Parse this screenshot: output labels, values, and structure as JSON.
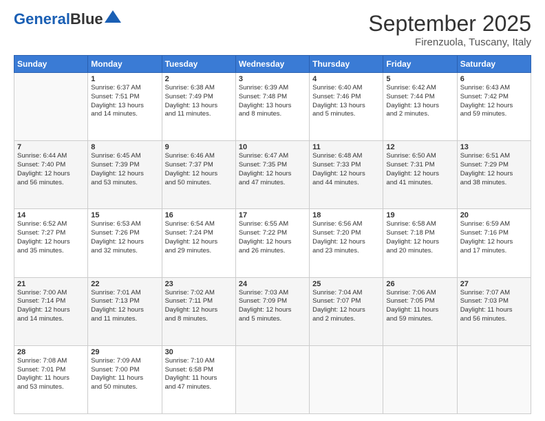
{
  "header": {
    "logo_line1": "General",
    "logo_line2": "Blue",
    "month": "September 2025",
    "location": "Firenzuola, Tuscany, Italy"
  },
  "weekdays": [
    "Sunday",
    "Monday",
    "Tuesday",
    "Wednesday",
    "Thursday",
    "Friday",
    "Saturday"
  ],
  "weeks": [
    [
      {
        "day": "",
        "content": ""
      },
      {
        "day": "1",
        "content": "Sunrise: 6:37 AM\nSunset: 7:51 PM\nDaylight: 13 hours\nand 14 minutes."
      },
      {
        "day": "2",
        "content": "Sunrise: 6:38 AM\nSunset: 7:49 PM\nDaylight: 13 hours\nand 11 minutes."
      },
      {
        "day": "3",
        "content": "Sunrise: 6:39 AM\nSunset: 7:48 PM\nDaylight: 13 hours\nand 8 minutes."
      },
      {
        "day": "4",
        "content": "Sunrise: 6:40 AM\nSunset: 7:46 PM\nDaylight: 13 hours\nand 5 minutes."
      },
      {
        "day": "5",
        "content": "Sunrise: 6:42 AM\nSunset: 7:44 PM\nDaylight: 13 hours\nand 2 minutes."
      },
      {
        "day": "6",
        "content": "Sunrise: 6:43 AM\nSunset: 7:42 PM\nDaylight: 12 hours\nand 59 minutes."
      }
    ],
    [
      {
        "day": "7",
        "content": "Sunrise: 6:44 AM\nSunset: 7:40 PM\nDaylight: 12 hours\nand 56 minutes."
      },
      {
        "day": "8",
        "content": "Sunrise: 6:45 AM\nSunset: 7:39 PM\nDaylight: 12 hours\nand 53 minutes."
      },
      {
        "day": "9",
        "content": "Sunrise: 6:46 AM\nSunset: 7:37 PM\nDaylight: 12 hours\nand 50 minutes."
      },
      {
        "day": "10",
        "content": "Sunrise: 6:47 AM\nSunset: 7:35 PM\nDaylight: 12 hours\nand 47 minutes."
      },
      {
        "day": "11",
        "content": "Sunrise: 6:48 AM\nSunset: 7:33 PM\nDaylight: 12 hours\nand 44 minutes."
      },
      {
        "day": "12",
        "content": "Sunrise: 6:50 AM\nSunset: 7:31 PM\nDaylight: 12 hours\nand 41 minutes."
      },
      {
        "day": "13",
        "content": "Sunrise: 6:51 AM\nSunset: 7:29 PM\nDaylight: 12 hours\nand 38 minutes."
      }
    ],
    [
      {
        "day": "14",
        "content": "Sunrise: 6:52 AM\nSunset: 7:27 PM\nDaylight: 12 hours\nand 35 minutes."
      },
      {
        "day": "15",
        "content": "Sunrise: 6:53 AM\nSunset: 7:26 PM\nDaylight: 12 hours\nand 32 minutes."
      },
      {
        "day": "16",
        "content": "Sunrise: 6:54 AM\nSunset: 7:24 PM\nDaylight: 12 hours\nand 29 minutes."
      },
      {
        "day": "17",
        "content": "Sunrise: 6:55 AM\nSunset: 7:22 PM\nDaylight: 12 hours\nand 26 minutes."
      },
      {
        "day": "18",
        "content": "Sunrise: 6:56 AM\nSunset: 7:20 PM\nDaylight: 12 hours\nand 23 minutes."
      },
      {
        "day": "19",
        "content": "Sunrise: 6:58 AM\nSunset: 7:18 PM\nDaylight: 12 hours\nand 20 minutes."
      },
      {
        "day": "20",
        "content": "Sunrise: 6:59 AM\nSunset: 7:16 PM\nDaylight: 12 hours\nand 17 minutes."
      }
    ],
    [
      {
        "day": "21",
        "content": "Sunrise: 7:00 AM\nSunset: 7:14 PM\nDaylight: 12 hours\nand 14 minutes."
      },
      {
        "day": "22",
        "content": "Sunrise: 7:01 AM\nSunset: 7:13 PM\nDaylight: 12 hours\nand 11 minutes."
      },
      {
        "day": "23",
        "content": "Sunrise: 7:02 AM\nSunset: 7:11 PM\nDaylight: 12 hours\nand 8 minutes."
      },
      {
        "day": "24",
        "content": "Sunrise: 7:03 AM\nSunset: 7:09 PM\nDaylight: 12 hours\nand 5 minutes."
      },
      {
        "day": "25",
        "content": "Sunrise: 7:04 AM\nSunset: 7:07 PM\nDaylight: 12 hours\nand 2 minutes."
      },
      {
        "day": "26",
        "content": "Sunrise: 7:06 AM\nSunset: 7:05 PM\nDaylight: 11 hours\nand 59 minutes."
      },
      {
        "day": "27",
        "content": "Sunrise: 7:07 AM\nSunset: 7:03 PM\nDaylight: 11 hours\nand 56 minutes."
      }
    ],
    [
      {
        "day": "28",
        "content": "Sunrise: 7:08 AM\nSunset: 7:01 PM\nDaylight: 11 hours\nand 53 minutes."
      },
      {
        "day": "29",
        "content": "Sunrise: 7:09 AM\nSunset: 7:00 PM\nDaylight: 11 hours\nand 50 minutes."
      },
      {
        "day": "30",
        "content": "Sunrise: 7:10 AM\nSunset: 6:58 PM\nDaylight: 11 hours\nand 47 minutes."
      },
      {
        "day": "",
        "content": ""
      },
      {
        "day": "",
        "content": ""
      },
      {
        "day": "",
        "content": ""
      },
      {
        "day": "",
        "content": ""
      }
    ]
  ]
}
